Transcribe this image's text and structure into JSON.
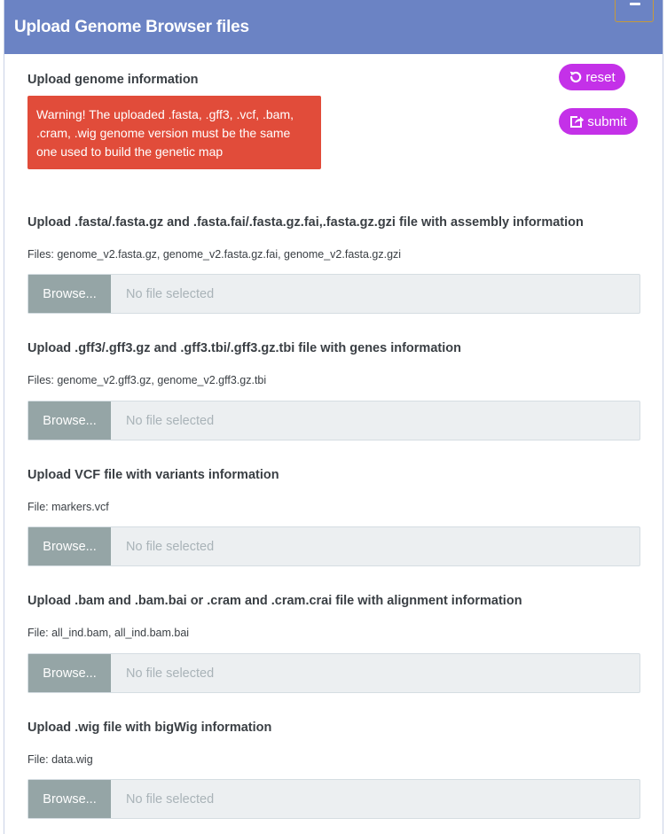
{
  "header": {
    "title": "Upload Genome Browser files"
  },
  "info": {
    "title": "Upload genome information",
    "warning": "Warning! The uploaded .fasta, .gff3, .vcf, .bam, .cram, .wig genome version must be the same one used to build the genetic map"
  },
  "buttons": {
    "reset": "reset",
    "submit": "submit"
  },
  "colors": {
    "header": "#6b83c4",
    "warning": "#e14c3a",
    "pill": "#c431e8",
    "browse": "#95a5a6"
  },
  "uploads": [
    {
      "title": "Upload .fasta/.fasta.gz and .fasta.fai/.fasta.gz.fai,.fasta.gz.gzi file with assembly information",
      "files": "Files: genome_v2.fasta.gz, genome_v2.fasta.gz.fai, genome_v2.fasta.gz.gzi",
      "browse": "Browse...",
      "placeholder": "No file selected"
    },
    {
      "title": "Upload .gff3/.gff3.gz and .gff3.tbi/.gff3.gz.tbi file with genes information",
      "files": "Files: genome_v2.gff3.gz, genome_v2.gff3.gz.tbi",
      "browse": "Browse...",
      "placeholder": "No file selected"
    },
    {
      "title": "Upload VCF file with variants information",
      "files": "File: markers.vcf",
      "browse": "Browse...",
      "placeholder": "No file selected"
    },
    {
      "title": "Upload .bam and .bam.bai or .cram and .cram.crai file with alignment information",
      "files": "File: all_ind.bam, all_ind.bam.bai",
      "browse": "Browse...",
      "placeholder": "No file selected"
    },
    {
      "title": "Upload .wig file with bigWig information",
      "files": "File: data.wig",
      "browse": "Browse...",
      "placeholder": "No file selected"
    }
  ]
}
